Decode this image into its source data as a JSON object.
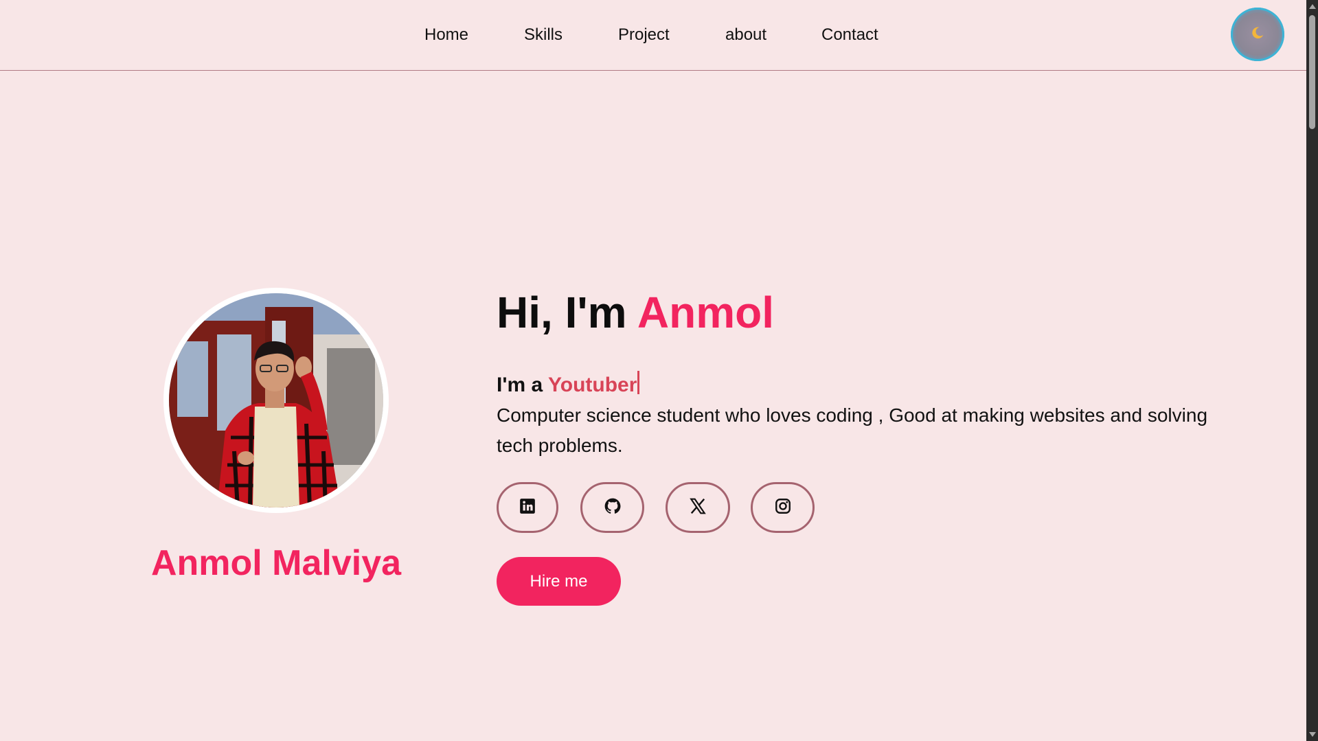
{
  "nav": {
    "links": [
      "Home",
      "Skills",
      "Project",
      "about",
      "Contact"
    ],
    "theme_toggle_icon": "moon-icon"
  },
  "profile": {
    "full_name": "Anmol Malviya",
    "avatar_alt": "profile photo"
  },
  "hero": {
    "greeting_prefix": "Hi, I'm ",
    "greeting_name": "Anmol",
    "role_prefix": "I'm a ",
    "role": "Youtuber",
    "description": "Computer science student who loves coding , Good at making websites and solving tech problems."
  },
  "socials": [
    {
      "name": "linkedin",
      "icon": "linkedin-icon"
    },
    {
      "name": "github",
      "icon": "github-icon"
    },
    {
      "name": "x",
      "icon": "x-icon"
    },
    {
      "name": "instagram",
      "icon": "instagram-icon"
    }
  ],
  "cta": {
    "hire_label": "Hire me"
  },
  "colors": {
    "background": "#f8e6e7",
    "accent": "#f2245f",
    "role_accent": "#d84457",
    "social_border": "#a5636f",
    "toggle_ring": "#3db4d6"
  }
}
